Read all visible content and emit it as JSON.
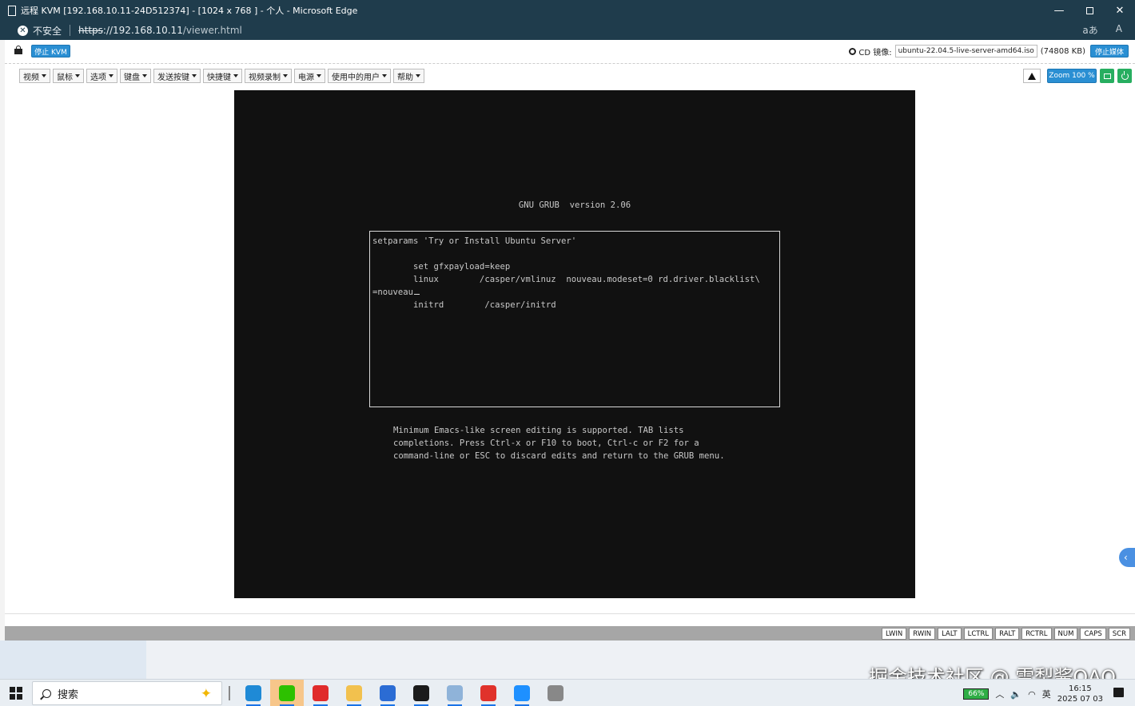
{
  "browser": {
    "title": "远程 KVM [192.168.10.11-24D512374] - [1024 x 768 ] - 个人 - Microsoft Edge",
    "security_text": "不安全",
    "url_protocol": "https",
    "url_host": "://192.168.10.11",
    "url_path": "/viewer.html",
    "icon_read_aloud": "aあ",
    "icon_text": "A"
  },
  "kvm": {
    "stop_kvm_label": "停止 KVM",
    "cd_label": "CD 镜像:",
    "cd_file": "ubuntu-22.04.5-live-server-amd64.iso",
    "cd_size": "(74808 KB)",
    "stop_media_label": "停止媒体",
    "menu": [
      "视频",
      "鼠标",
      "选项",
      "键盘",
      "发送按键",
      "快捷键",
      "视频录制",
      "电源",
      "使用中的用户",
      "帮助"
    ],
    "zoom_label": "Zoom 100 %",
    "status_keys": [
      "LWIN",
      "RWIN",
      "LALT",
      "LCTRL",
      "RALT",
      "RCTRL",
      "NUM",
      "CAPS",
      "SCR"
    ]
  },
  "grub": {
    "title": "GNU GRUB  version 2.06",
    "lines": [
      "setparams 'Try or Install Ubuntu Server'",
      "",
      "        set gfxpayload=keep",
      "        linux        /casper/vmlinuz  nouveau.modeset=0 rd.driver.blacklist\\",
      "=nouveau",
      "        initrd        /casper/initrd"
    ],
    "help": [
      "Minimum Emacs-like screen editing is supported. TAB lists",
      "completions. Press Ctrl-x or F10 to boot, Ctrl-c or F2 for a",
      "command-line or ESC to discard edits and return to the GRUB menu."
    ]
  },
  "taskbar": {
    "search_label": "搜索",
    "battery": "66%",
    "ime": "英",
    "time": "16:15",
    "date": "2025 07 03",
    "apps": [
      {
        "name": "edge",
        "color": "#1f8ad6"
      },
      {
        "name": "wechat",
        "color": "#2dc100"
      },
      {
        "name": "netease-music",
        "color": "#e02b2b"
      },
      {
        "name": "file-explorer",
        "color": "#f2c14e"
      },
      {
        "name": "camera-app",
        "color": "#2b6cd4"
      },
      {
        "name": "terminal",
        "color": "#1b1b1b"
      },
      {
        "name": "files-app",
        "color": "#8fb3d9"
      },
      {
        "name": "wps",
        "color": "#e0322b"
      },
      {
        "name": "remote-app",
        "color": "#1e90ff"
      },
      {
        "name": "printer-app",
        "color": "#888888"
      }
    ]
  },
  "watermark": "掘金技术社区 @ 雪梨酱QAQ"
}
